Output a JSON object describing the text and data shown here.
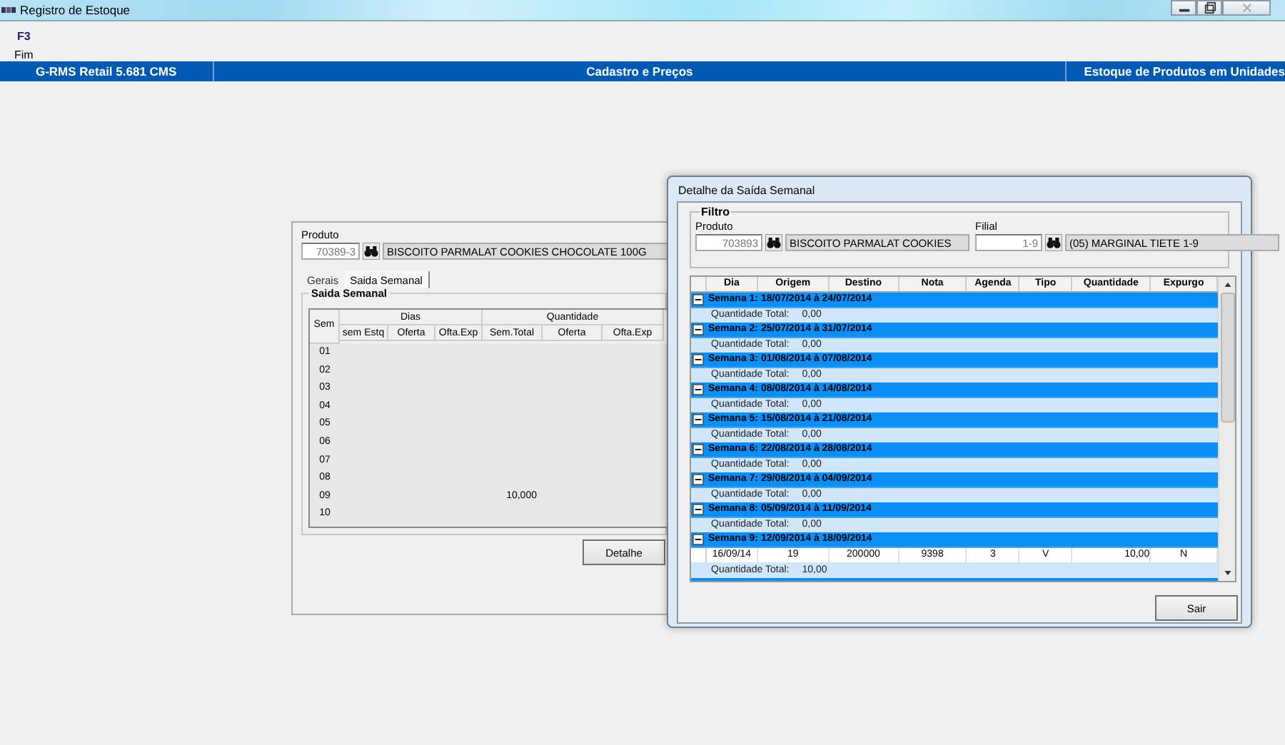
{
  "window": {
    "title": "Registro de Estoque"
  },
  "toolbar": [
    {
      "key": "F3",
      "label": "Fim"
    }
  ],
  "header_bar": [
    "G-RMS Retail 5.681 CMS",
    "Cadastro e Preços",
    "Estoque de Produtos em Unidades"
  ],
  "estoque_form": {
    "produto_label": "Produto",
    "product_code": "70389-3",
    "product_name": "BISCOITO PARMALAT COOKIES CHOCOLATE 100G",
    "tabs": [
      {
        "label": "Gerais",
        "selected": false
      },
      {
        "label": "Saida Semanal",
        "selected": true
      }
    ],
    "group_title": "Saida Semanal",
    "table": {
      "group_headers": [
        "Dias",
        "Quantidade"
      ],
      "columns": [
        "Sem",
        "sem Estq",
        "Oferta",
        "Ofta.Exp",
        "Sem.Total",
        "Oferta",
        "Ofta.Exp"
      ],
      "rows": [
        {
          "sem": "01"
        },
        {
          "sem": "02"
        },
        {
          "sem": "03"
        },
        {
          "sem": "04"
        },
        {
          "sem": "05"
        },
        {
          "sem": "06"
        },
        {
          "sem": "07"
        },
        {
          "sem": "08"
        },
        {
          "sem": "09",
          "sem_total": "10,000"
        },
        {
          "sem": "10"
        }
      ]
    },
    "detail_button": "Detalhe"
  },
  "dialog": {
    "title": "Detalhe da Saída Semanal",
    "filter_title": "Filtro",
    "produto_label": "Produto",
    "product_code": "703893",
    "product_name": "BISCOITO PARMALAT COOKIES",
    "filial_label": "Filial",
    "filial_code": "1-9",
    "filial_name": "(05) MARGINAL TIETE 1-9",
    "columns": [
      "Dia",
      "Origem",
      "Destino",
      "Nota",
      "Agenda",
      "Tipo",
      "Quantidade",
      "Expurgo"
    ],
    "weeks": [
      {
        "title": "Semana 1: 18/07/2014 à 24/07/2014",
        "expanded": true,
        "total_label": "Quantidade Total:",
        "total": "0,00"
      },
      {
        "title": "Semana 2: 25/07/2014 à 31/07/2014",
        "expanded": true,
        "total_label": "Quantidade Total:",
        "total": "0,00"
      },
      {
        "title": "Semana 3: 01/08/2014 à 07/08/2014",
        "expanded": true,
        "total_label": "Quantidade Total:",
        "total": "0,00"
      },
      {
        "title": "Semana 4: 08/08/2014 à 14/08/2014",
        "expanded": true,
        "total_label": "Quantidade Total:",
        "total": "0,00"
      },
      {
        "title": "Semana 5: 15/08/2014 à 21/08/2014",
        "expanded": true,
        "total_label": "Quantidade Total:",
        "total": "0,00"
      },
      {
        "title": "Semana 6: 22/08/2014 à 28/08/2014",
        "expanded": true,
        "total_label": "Quantidade Total:",
        "total": "0,00"
      },
      {
        "title": "Semana 7: 29/08/2014 à 04/09/2014",
        "expanded": true,
        "total_label": "Quantidade Total:",
        "total": "0,00"
      },
      {
        "title": "Semana 8: 05/09/2014 à 11/09/2014",
        "expanded": true,
        "total_label": "Quantidade Total:",
        "total": "0,00"
      },
      {
        "title": "Semana 9: 12/09/2014 à 18/09/2014",
        "expanded": true,
        "items": [
          {
            "cells": [
              "16/09/14",
              "19",
              "200000",
              "9398",
              "3",
              "V",
              "10,00",
              "N"
            ]
          }
        ],
        "total_label": "Quantidade Total:",
        "total": "10,00"
      }
    ],
    "exit_button": "Sair"
  }
}
